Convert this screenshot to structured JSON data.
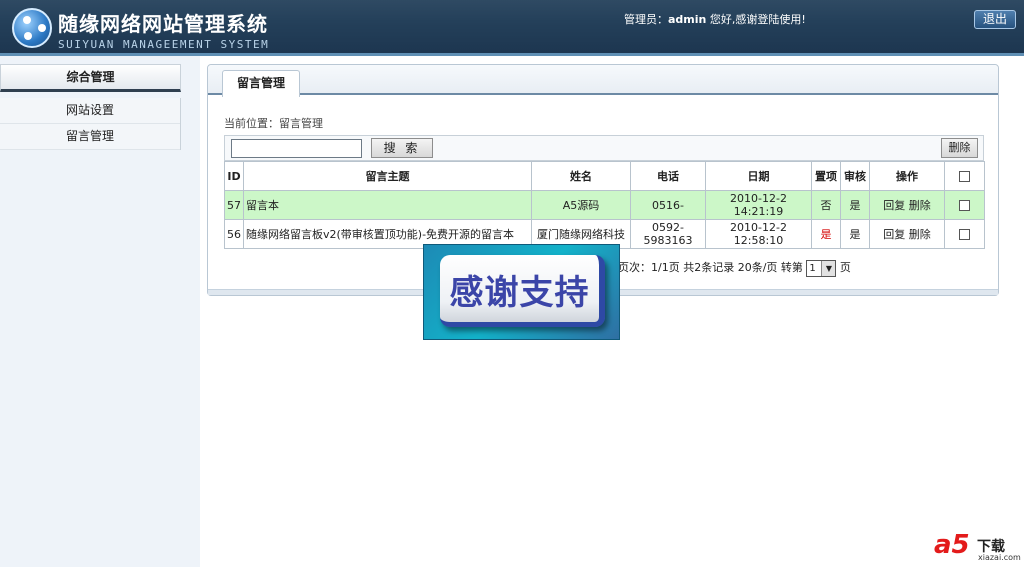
{
  "header": {
    "title": "随缘网络网站管理系统",
    "subtitle": "SUIYUAN MANAGEEMENT SYSTEM",
    "admin_prefix": "管理员：",
    "admin_name": "admin",
    "admin_suffix": " 您好,感谢登陆使用!",
    "logout_label": "退出"
  },
  "sidebar": {
    "heading": "综合管理",
    "items": [
      {
        "label": "网站设置"
      },
      {
        "label": "留言管理"
      }
    ]
  },
  "main": {
    "tab_label": "留言管理",
    "breadcrumb": "当前位置：留言管理",
    "search": {
      "value": "",
      "placeholder": "",
      "button_label": "搜 索"
    },
    "delete_label": "删除",
    "columns": [
      "ID",
      "留言主题",
      "姓名",
      "电话",
      "日期",
      "置项",
      "审核",
      "操作"
    ],
    "rows": [
      {
        "id": "57",
        "subject": "留言本",
        "name": "A5源码",
        "phone": "0516-",
        "date": "2010-12-2 14:21:19",
        "top": "否",
        "audit": "是",
        "reply": "回复",
        "delete": "删除",
        "style": "green"
      },
      {
        "id": "56",
        "subject": "随缘网络留言板v2(带审核置顶功能)-免费开源的留言本",
        "name": "厦门随缘网络科技",
        "phone": "0592-5983163",
        "date": "2010-12-2 12:58:10",
        "top": "是",
        "audit": "是",
        "reply": "回复",
        "delete": "删除",
        "style": "white"
      }
    ],
    "pager": {
      "text": "页次：1/1页 共2条记录 20条/页 转第",
      "select_value": "1",
      "suffix": "页"
    }
  },
  "overlay": {
    "text": "感谢支持"
  },
  "watermark": {
    "logo": "a5",
    "text": "下载",
    "site": "xiazai.com"
  },
  "colors": {
    "header_bg": "#24405a",
    "row_highlight": "#ccf7c8",
    "accent_red": "#d40000",
    "overlay_text": "#3b45a8"
  }
}
